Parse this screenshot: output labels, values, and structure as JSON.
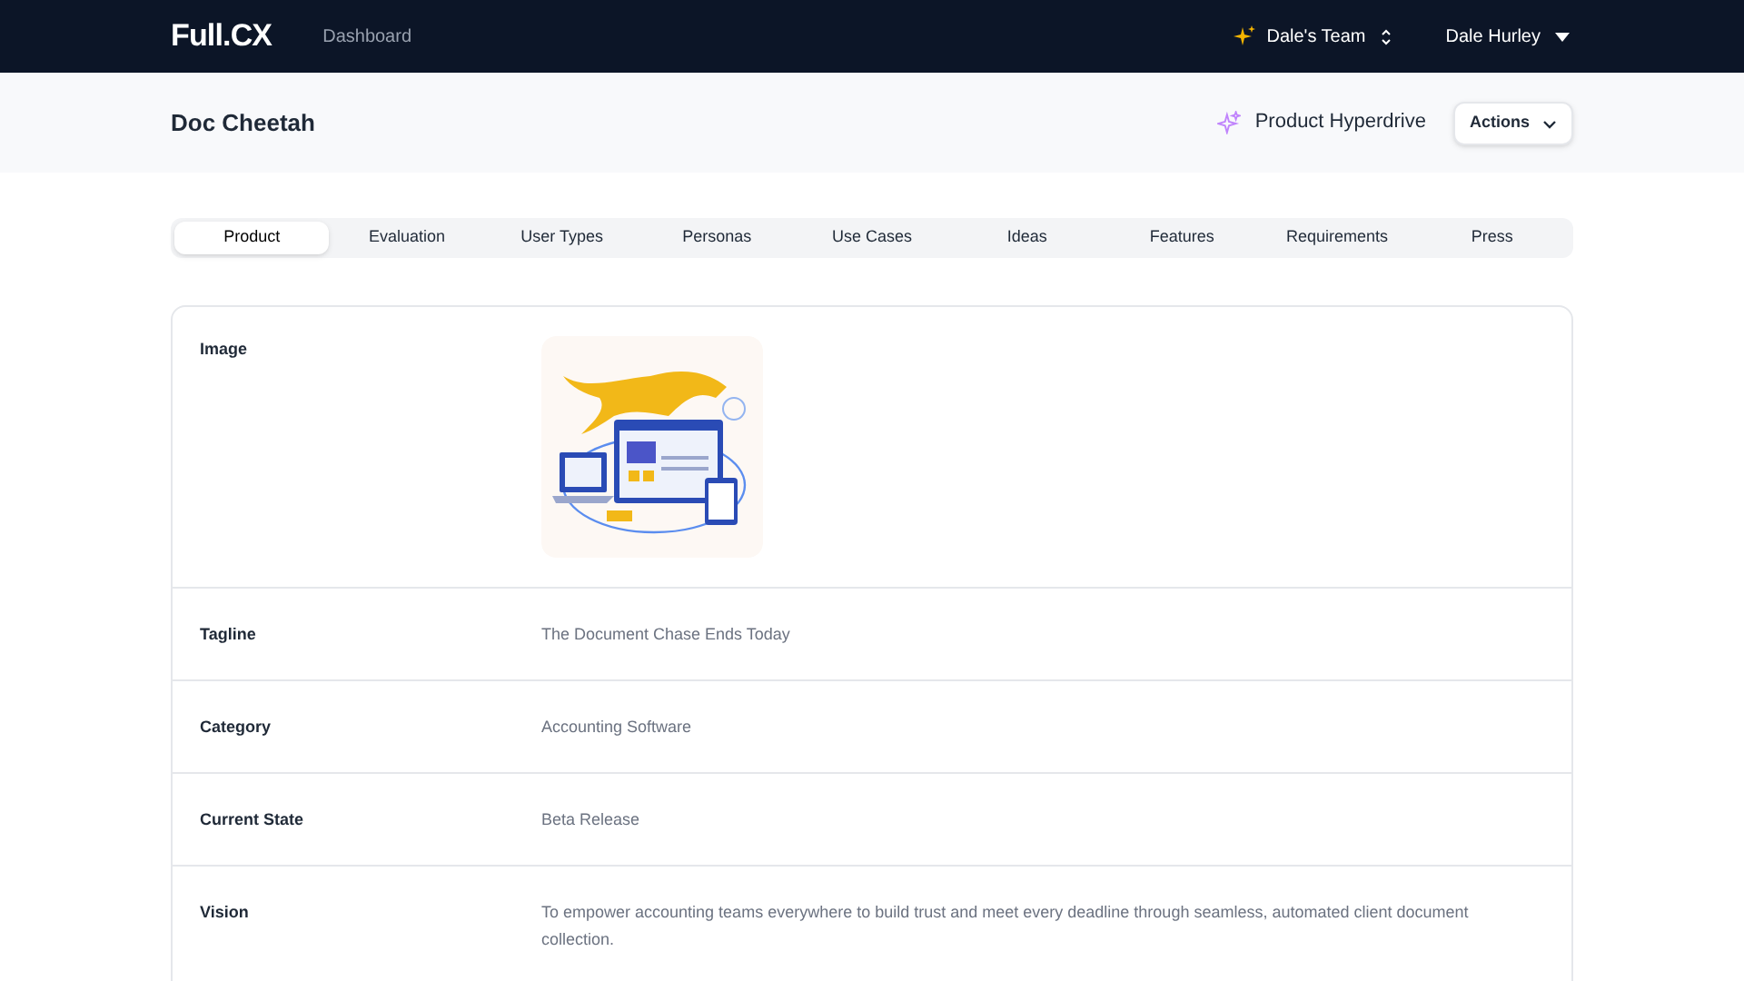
{
  "nav": {
    "logo": "Full.CX",
    "link": "Dashboard",
    "team": "Dale's Team",
    "user": "Dale Hurley"
  },
  "header": {
    "title": "Doc Cheetah",
    "hyperdrive": "Product Hyperdrive",
    "actions": "Actions"
  },
  "tabs": [
    {
      "label": "Product",
      "selected": true
    },
    {
      "label": "Evaluation",
      "selected": false
    },
    {
      "label": "User Types",
      "selected": false
    },
    {
      "label": "Personas",
      "selected": false
    },
    {
      "label": "Use Cases",
      "selected": false
    },
    {
      "label": "Ideas",
      "selected": false
    },
    {
      "label": "Features",
      "selected": false
    },
    {
      "label": "Requirements",
      "selected": false
    },
    {
      "label": "Press",
      "selected": false
    }
  ],
  "fields": [
    {
      "label": "Image",
      "kind": "image"
    },
    {
      "label": "Tagline",
      "kind": "text",
      "value": "The Document Chase Ends Today"
    },
    {
      "label": "Category",
      "kind": "text",
      "value": "Accounting Software"
    },
    {
      "label": "Current State",
      "kind": "text",
      "value": "Beta Release"
    },
    {
      "label": "Vision",
      "kind": "text",
      "value": "To empower accounting teams everywhere to build trust and meet every deadline through seamless, automated client document collection."
    }
  ]
}
